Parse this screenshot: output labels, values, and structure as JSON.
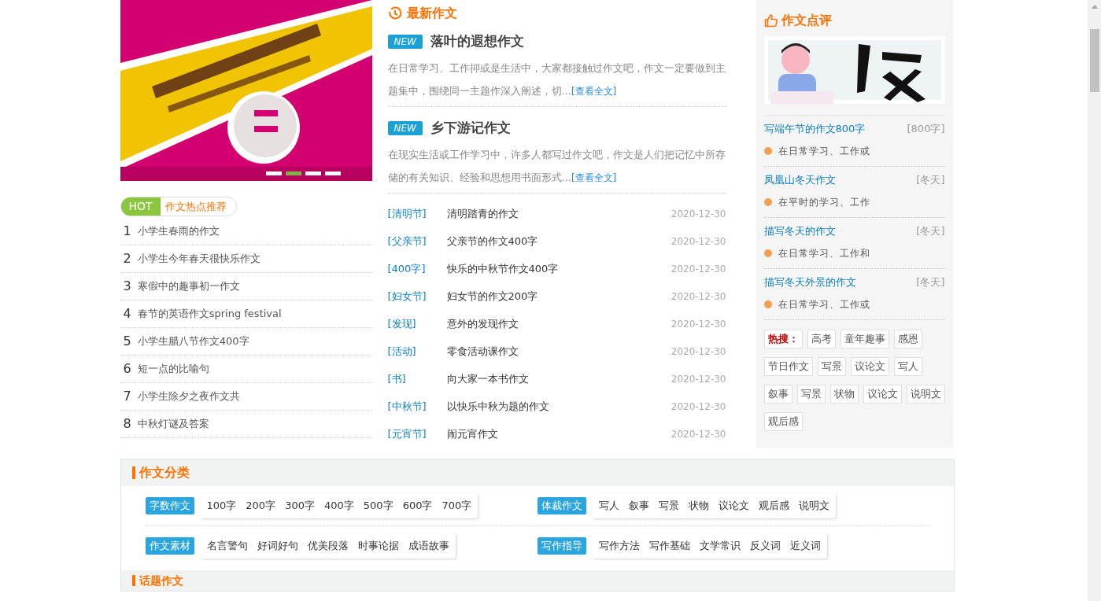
{
  "banner": {
    "dots": [
      {
        "selected": false
      },
      {
        "selected": true
      },
      {
        "selected": false
      },
      {
        "selected": false
      }
    ]
  },
  "hot": {
    "badge": "HOT",
    "title": "作文热点推荐",
    "items": [
      {
        "rank": "1",
        "title": "小学生春雨的作文"
      },
      {
        "rank": "2",
        "title": "小学生今年春天很快乐作文"
      },
      {
        "rank": "3",
        "title": "寒假中的趣事初一作文"
      },
      {
        "rank": "4",
        "title": "春节的英语作文spring festival"
      },
      {
        "rank": "5",
        "title": "小学生腊八节作文400字"
      },
      {
        "rank": "6",
        "title": "短一点的比喻句"
      },
      {
        "rank": "7",
        "title": "小学生除夕之夜作文共"
      },
      {
        "rank": "8",
        "title": "中秋灯谜及答案"
      }
    ]
  },
  "latest": {
    "title": "最新作文",
    "featured": [
      {
        "badge": "NEW",
        "title": "落叶的遐想作文",
        "summary": "在日常学习、工作抑或是生活中，大家都接触过作文吧，作文一定要做到主题集中，围绕同一主题作深入阐述，切...",
        "more": "[查看全文]"
      },
      {
        "badge": "NEW",
        "title": "乡下游记作文",
        "summary": "在现实生活或工作学习中，许多人都写过作文吧，作文是人们把记忆中所存储的有关知识、经验和思想用书面形式...",
        "more": "[查看全文]"
      }
    ],
    "items": [
      {
        "tag": "[清明节]",
        "title": "清明踏青的作文",
        "date": "2020-12-30"
      },
      {
        "tag": "[父亲节]",
        "title": "父亲节的作文400字",
        "date": "2020-12-30"
      },
      {
        "tag": "[400字]",
        "title": "快乐的中秋节作文400字",
        "date": "2020-12-30"
      },
      {
        "tag": "[妇女节]",
        "title": "妇女节的作文200字",
        "date": "2020-12-30"
      },
      {
        "tag": "[发现]",
        "title": "意外的发现作文",
        "date": "2020-12-30"
      },
      {
        "tag": "[活动]",
        "title": "零食活动课作文",
        "date": "2020-12-30"
      },
      {
        "tag": "[书]",
        "title": "向大家一本书作文",
        "date": "2020-12-30"
      },
      {
        "tag": "[中秋节]",
        "title": "以快乐中秋为题的作文",
        "date": "2020-12-30"
      },
      {
        "tag": "[元宵节]",
        "title": "闹元宵作文",
        "date": "2020-12-30"
      }
    ]
  },
  "review": {
    "title": "作文点评",
    "items": [
      {
        "title": "写端午节的作文800字",
        "tag": "[800字]",
        "excerpt": "在日常学习、工作或"
      },
      {
        "title": "凤凰山冬天作文",
        "tag": "[冬天]",
        "excerpt": "在平时的学习、工作"
      },
      {
        "title": "描写冬天的作文",
        "tag": "[冬天]",
        "excerpt": "在日常学习、工作和"
      },
      {
        "title": "描写冬天外景的作文",
        "tag": "[冬天]",
        "excerpt": "在日常学习、工作或"
      }
    ],
    "hot_search_label": "热搜：",
    "hot_search": [
      "高考",
      "童年趣事",
      "感恩",
      "节日作文",
      "写景",
      "议论文",
      "写人",
      "叙事",
      "写景",
      "状物",
      "议论文",
      "说明文",
      "观后感"
    ]
  },
  "categories": {
    "title": "作文分类",
    "groups": [
      {
        "label": "字数作文",
        "links": [
          "100字",
          "200字",
          "300字",
          "400字",
          "500字",
          "600字",
          "700字"
        ]
      },
      {
        "label": "体裁作文",
        "links": [
          "写人",
          "叙事",
          "写景",
          "状物",
          "议论文",
          "观后感",
          "说明文"
        ]
      },
      {
        "label": "作文素材",
        "links": [
          "名言警句",
          "好词好句",
          "优美段落",
          "时事论据",
          "成语故事"
        ]
      },
      {
        "label": "写作指导",
        "links": [
          "写作方法",
          "写作基础",
          "文学常识",
          "反义词",
          "近义词"
        ]
      }
    ]
  },
  "next_section": {
    "title": "话题作文"
  }
}
